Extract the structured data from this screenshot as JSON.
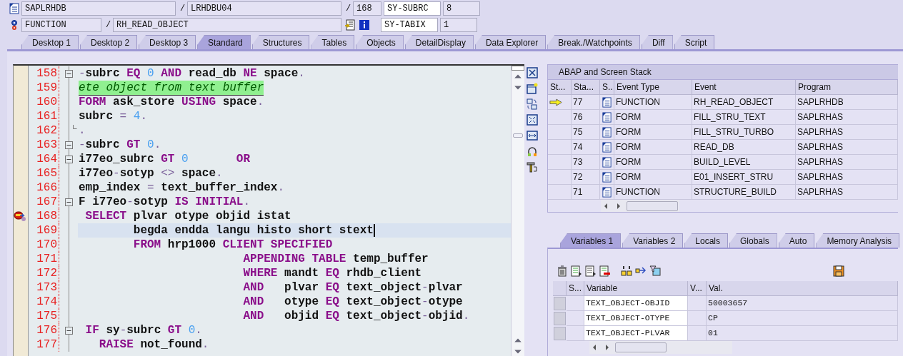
{
  "header": {
    "program": "SAPLRHDB",
    "include": "LRHDBU04",
    "line": "168",
    "event_type": "FUNCTION",
    "event": "RH_READ_OBJECT",
    "separators": [
      "/",
      "/",
      "/"
    ],
    "fields": [
      {
        "name": "SY-SUBRC",
        "value": "8"
      },
      {
        "name": "SY-TABIX",
        "value": "1"
      }
    ]
  },
  "tabs": [
    {
      "label": "Desktop 1",
      "selected": false
    },
    {
      "label": "Desktop 2",
      "selected": false
    },
    {
      "label": "Desktop 3",
      "selected": false
    },
    {
      "label": "Standard",
      "selected": true
    },
    {
      "label": "Structures",
      "selected": false
    },
    {
      "label": "Tables",
      "selected": false
    },
    {
      "label": "Objects",
      "selected": false
    },
    {
      "label": "DetailDisplay",
      "selected": false
    },
    {
      "label": "Data Explorer",
      "selected": false
    },
    {
      "label": "Break./Watchpoints",
      "selected": false
    },
    {
      "label": "Diff",
      "selected": false
    },
    {
      "label": "Script",
      "selected": false
    }
  ],
  "code": {
    "lines": [
      {
        "number": "158",
        "fold_start": true,
        "fold_end": false,
        "breakpoint": false,
        "current": false,
        "tokens": [
          {
            "kind": "op",
            "text": "-"
          },
          {
            "kind": "id",
            "text": "subrc "
          },
          {
            "kind": "kw",
            "text": "EQ"
          },
          {
            "kind": "num",
            "text": " 0"
          },
          {
            "kind": "kw",
            "text": " AND"
          },
          {
            "kind": "id",
            "text": " read_db "
          },
          {
            "kind": "kw",
            "text": "NE"
          },
          {
            "kind": "id",
            "text": " space"
          },
          {
            "kind": "op",
            "text": "."
          }
        ]
      },
      {
        "number": "159",
        "fold_start": false,
        "fold_end": false,
        "breakpoint": false,
        "current": false,
        "tokens": [
          {
            "kind": "comment",
            "text": "ete object from text buffer"
          }
        ]
      },
      {
        "number": "160",
        "fold_start": false,
        "fold_end": false,
        "breakpoint": false,
        "current": false,
        "tokens": [
          {
            "kind": "kw",
            "text": "FORM"
          },
          {
            "kind": "id",
            "text": " ask_store "
          },
          {
            "kind": "kw",
            "text": "USING"
          },
          {
            "kind": "id",
            "text": " space"
          },
          {
            "kind": "op",
            "text": "."
          }
        ]
      },
      {
        "number": "161",
        "fold_start": false,
        "fold_end": false,
        "breakpoint": false,
        "current": false,
        "tokens": [
          {
            "kind": "id",
            "text": "subrc "
          },
          {
            "kind": "op",
            "text": "="
          },
          {
            "kind": "num",
            "text": " 4"
          },
          {
            "kind": "op",
            "text": "."
          }
        ]
      },
      {
        "number": "162",
        "fold_start": false,
        "fold_end": true,
        "breakpoint": false,
        "current": false,
        "tokens": [
          {
            "kind": "op",
            "text": "."
          }
        ]
      },
      {
        "number": "163",
        "fold_start": true,
        "fold_end": false,
        "breakpoint": false,
        "current": false,
        "tokens": [
          {
            "kind": "op",
            "text": "-"
          },
          {
            "kind": "id",
            "text": "subrc "
          },
          {
            "kind": "kw",
            "text": "GT"
          },
          {
            "kind": "num",
            "text": " 0"
          },
          {
            "kind": "op",
            "text": "."
          }
        ]
      },
      {
        "number": "164",
        "fold_start": true,
        "fold_end": false,
        "breakpoint": false,
        "current": false,
        "tokens": [
          {
            "kind": "id",
            "text": "i77eo_subrc "
          },
          {
            "kind": "kw",
            "text": "GT"
          },
          {
            "kind": "num",
            "text": " 0"
          },
          {
            "kind": "kw",
            "text": "       OR"
          }
        ]
      },
      {
        "number": "165",
        "fold_start": false,
        "fold_end": false,
        "breakpoint": false,
        "current": false,
        "tokens": [
          {
            "kind": "id",
            "text": "i77eo"
          },
          {
            "kind": "op",
            "text": "-"
          },
          {
            "kind": "id",
            "text": "sotyp "
          },
          {
            "kind": "op",
            "text": "<>"
          },
          {
            "kind": "id",
            "text": " space"
          },
          {
            "kind": "op",
            "text": "."
          }
        ]
      },
      {
        "number": "166",
        "fold_start": false,
        "fold_end": false,
        "breakpoint": false,
        "current": false,
        "tokens": [
          {
            "kind": "id",
            "text": "emp_index "
          },
          {
            "kind": "op",
            "text": "="
          },
          {
            "kind": "id",
            "text": " text_buffer_index"
          },
          {
            "kind": "op",
            "text": "."
          }
        ]
      },
      {
        "number": "167",
        "fold_start": true,
        "fold_end": false,
        "breakpoint": false,
        "current": false,
        "tokens": [
          {
            "kind": "id",
            "text": "F i77eo"
          },
          {
            "kind": "op",
            "text": "-"
          },
          {
            "kind": "id",
            "text": "sotyp "
          },
          {
            "kind": "kw",
            "text": "IS INITIAL"
          },
          {
            "kind": "op",
            "text": "."
          }
        ]
      },
      {
        "number": "168",
        "fold_start": false,
        "fold_end": false,
        "breakpoint": true,
        "current": false,
        "tokens": [
          {
            "kind": "kw",
            "text": " SELECT"
          },
          {
            "kind": "id",
            "text": " plvar otype objid istat"
          }
        ]
      },
      {
        "number": "169",
        "fold_start": false,
        "fold_end": false,
        "breakpoint": false,
        "current": true,
        "tokens": [
          {
            "kind": "id",
            "text": "        begda endda langu histo short stext"
          }
        ]
      },
      {
        "number": "170",
        "fold_start": false,
        "fold_end": false,
        "breakpoint": false,
        "current": false,
        "tokens": [
          {
            "kind": "kw",
            "text": "        FROM"
          },
          {
            "kind": "id",
            "text": " hrp1000 "
          },
          {
            "kind": "kw",
            "text": "CLIENT SPECIFIED"
          }
        ]
      },
      {
        "number": "171",
        "fold_start": false,
        "fold_end": false,
        "breakpoint": false,
        "current": false,
        "tokens": [
          {
            "kind": "kw",
            "text": "                        APPENDING TABLE"
          },
          {
            "kind": "id",
            "text": " temp_buffer"
          }
        ]
      },
      {
        "number": "172",
        "fold_start": false,
        "fold_end": false,
        "breakpoint": false,
        "current": false,
        "tokens": [
          {
            "kind": "kw",
            "text": "                        WHERE"
          },
          {
            "kind": "id",
            "text": " mandt "
          },
          {
            "kind": "kw",
            "text": "EQ"
          },
          {
            "kind": "id",
            "text": " rhdb_client"
          }
        ]
      },
      {
        "number": "173",
        "fold_start": false,
        "fold_end": false,
        "breakpoint": false,
        "current": false,
        "tokens": [
          {
            "kind": "kw",
            "text": "                        AND"
          },
          {
            "kind": "id",
            "text": "   plvar "
          },
          {
            "kind": "kw",
            "text": "EQ"
          },
          {
            "kind": "id",
            "text": " text_object"
          },
          {
            "kind": "op",
            "text": "-"
          },
          {
            "kind": "id",
            "text": "plvar"
          }
        ]
      },
      {
        "number": "174",
        "fold_start": false,
        "fold_end": false,
        "breakpoint": false,
        "current": false,
        "tokens": [
          {
            "kind": "kw",
            "text": "                        AND"
          },
          {
            "kind": "id",
            "text": "   otype "
          },
          {
            "kind": "kw",
            "text": "EQ"
          },
          {
            "kind": "id",
            "text": " text_object"
          },
          {
            "kind": "op",
            "text": "-"
          },
          {
            "kind": "id",
            "text": "otype"
          }
        ]
      },
      {
        "number": "175",
        "fold_start": false,
        "fold_end": false,
        "breakpoint": false,
        "current": false,
        "tokens": [
          {
            "kind": "kw",
            "text": "                        AND"
          },
          {
            "kind": "id",
            "text": "   objid "
          },
          {
            "kind": "kw",
            "text": "EQ"
          },
          {
            "kind": "id",
            "text": " text_object"
          },
          {
            "kind": "op",
            "text": "-"
          },
          {
            "kind": "id",
            "text": "objid"
          },
          {
            "kind": "op",
            "text": "."
          }
        ]
      },
      {
        "number": "176",
        "fold_start": true,
        "fold_end": false,
        "breakpoint": false,
        "current": false,
        "tokens": [
          {
            "kind": "kw",
            "text": " IF"
          },
          {
            "kind": "id",
            "text": " sy"
          },
          {
            "kind": "op",
            "text": "-"
          },
          {
            "kind": "id",
            "text": "subrc "
          },
          {
            "kind": "kw",
            "text": "GT"
          },
          {
            "kind": "num",
            "text": " 0"
          },
          {
            "kind": "op",
            "text": "."
          }
        ]
      },
      {
        "number": "177",
        "fold_start": false,
        "fold_end": false,
        "breakpoint": false,
        "current": false,
        "tokens": [
          {
            "kind": "kw",
            "text": "   RAISE"
          },
          {
            "kind": "id",
            "text": " not_found"
          },
          {
            "kind": "op",
            "text": "."
          }
        ]
      }
    ]
  },
  "stack": {
    "title": "ABAP and Screen Stack",
    "columns": [
      "St...",
      "Sta...",
      "S..",
      "Event Type",
      "Event",
      "Program"
    ],
    "rows": [
      {
        "current": true,
        "stack_level": "77",
        "event_type": "FUNCTION",
        "event": "RH_READ_OBJECT",
        "program": "SAPLRHDB"
      },
      {
        "current": false,
        "stack_level": "76",
        "event_type": "FORM",
        "event": "FILL_STRU_TEXT",
        "program": "SAPLRHAS"
      },
      {
        "current": false,
        "stack_level": "75",
        "event_type": "FORM",
        "event": "FILL_STRU_TURBO",
        "program": "SAPLRHAS"
      },
      {
        "current": false,
        "stack_level": "74",
        "event_type": "FORM",
        "event": "READ_DB",
        "program": "SAPLRHAS"
      },
      {
        "current": false,
        "stack_level": "73",
        "event_type": "FORM",
        "event": "BUILD_LEVEL",
        "program": "SAPLRHAS"
      },
      {
        "current": false,
        "stack_level": "72",
        "event_type": "FORM",
        "event": "E01_INSERT_STRU",
        "program": "SAPLRHAS"
      },
      {
        "current": false,
        "stack_level": "71",
        "event_type": "FUNCTION",
        "event": "STRUCTURE_BUILD",
        "program": "SAPLRHAS"
      }
    ]
  },
  "variables": {
    "tabs": [
      {
        "label": "Variables 1",
        "selected": true
      },
      {
        "label": "Variables 2",
        "selected": false
      },
      {
        "label": "Locals",
        "selected": false
      },
      {
        "label": "Globals",
        "selected": false
      },
      {
        "label": "Auto",
        "selected": false
      },
      {
        "label": "Memory Analysis",
        "selected": false
      }
    ],
    "columns": [
      "S...",
      "Variable",
      "V...",
      "Val."
    ],
    "rows": [
      {
        "variable": "TEXT_OBJECT-OBJID",
        "value": "50003657"
      },
      {
        "variable": "TEXT_OBJECT-OTYPE",
        "value": "CP"
      },
      {
        "variable": "TEXT_OBJECT-PLVAR",
        "value": "01"
      }
    ]
  }
}
